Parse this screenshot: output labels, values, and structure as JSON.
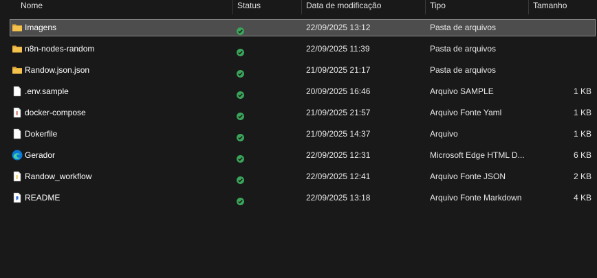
{
  "columns": {
    "name": "Nome",
    "status": "Status",
    "date": "Data de modificação",
    "type": "Tipo",
    "size": "Tamanho"
  },
  "colors": {
    "background": "#191919",
    "selected_row": "#4d4d4d",
    "folder": "#f4c14c",
    "status_ok": "#3aa55a"
  },
  "files": [
    {
      "name": "Imagens",
      "icon": "folder-icon",
      "status": "synced-icon",
      "date": "22/09/2025 13:12",
      "type": "Pasta de arquivos",
      "size": "",
      "selected": true
    },
    {
      "name": "n8n-nodes-random",
      "icon": "folder-icon",
      "status": "synced-icon",
      "date": "22/09/2025 11:39",
      "type": "Pasta de arquivos",
      "size": ""
    },
    {
      "name": "Randow.json.json",
      "icon": "folder-icon",
      "status": "synced-icon",
      "date": "21/09/2025 21:17",
      "type": "Pasta de arquivos",
      "size": ""
    },
    {
      "name": ".env.sample",
      "icon": "file-icon",
      "status": "synced-icon",
      "date": "20/09/2025 16:46",
      "type": "Arquivo SAMPLE",
      "size": "1 KB"
    },
    {
      "name": "docker-compose",
      "icon": "yaml-file-icon",
      "status": "synced-icon",
      "date": "21/09/2025 21:57",
      "type": "Arquivo Fonte Yaml",
      "size": "1 KB"
    },
    {
      "name": "Dokerfile",
      "icon": "file-icon",
      "status": "synced-icon",
      "date": "21/09/2025 14:37",
      "type": "Arquivo",
      "size": "1 KB"
    },
    {
      "name": "Gerador",
      "icon": "edge-html-icon",
      "status": "synced-icon",
      "date": "22/09/2025 12:31",
      "type": "Microsoft Edge HTML D...",
      "size": "6 KB"
    },
    {
      "name": "Randow_workflow",
      "icon": "json-file-icon",
      "status": "synced-icon",
      "date": "22/09/2025 12:41",
      "type": "Arquivo Fonte JSON",
      "size": "2 KB"
    },
    {
      "name": "README",
      "icon": "markdown-file-icon",
      "status": "synced-icon",
      "date": "22/09/2025 13:18",
      "type": "Arquivo Fonte Markdown",
      "size": "4 KB"
    }
  ]
}
